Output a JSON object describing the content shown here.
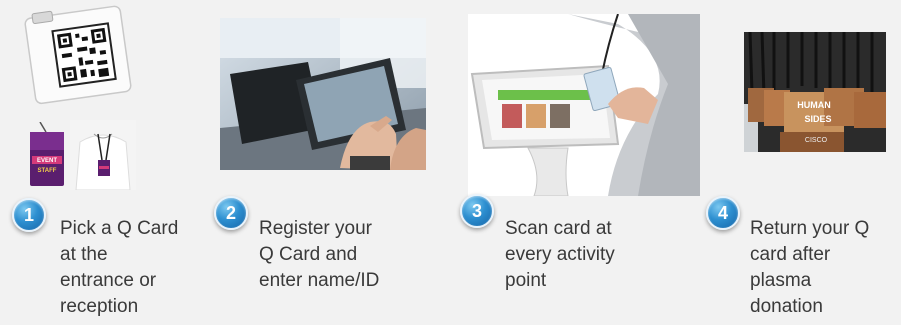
{
  "steps": [
    {
      "number": "1",
      "text": "Pick a Q Card\nat the\nentrance or\nreception"
    },
    {
      "number": "2",
      "text": "Register your\nQ Card and\nenter name/ID"
    },
    {
      "number": "3",
      "text": "Scan card at\nevery activity\npoint"
    },
    {
      "number": "4",
      "text": "Return your Q\ncard after\nplasma\ndonation"
    }
  ],
  "images": {
    "card_badge_text": "EVENT STAFF",
    "tags_text": "HUMAN SIDES CISCO"
  },
  "colors": {
    "badge": "#2d8fd0",
    "text": "#3a3a3a",
    "background": "#f2f2f2"
  }
}
